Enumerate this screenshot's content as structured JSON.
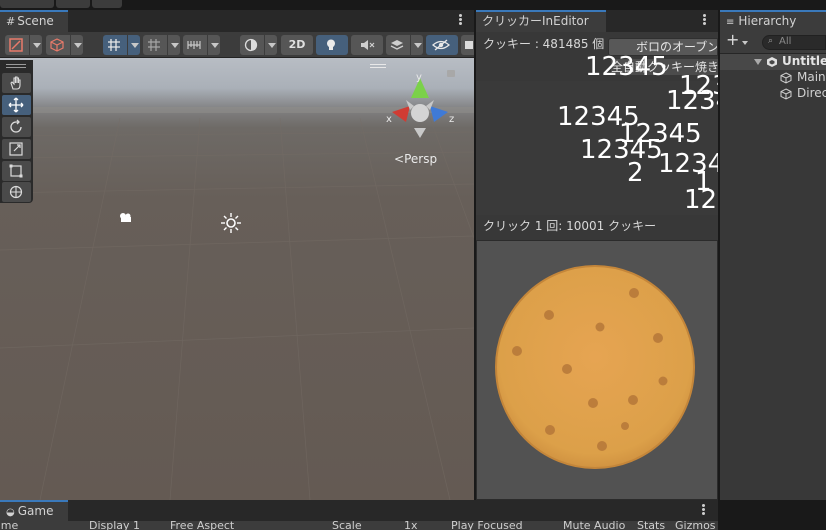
{
  "scene": {
    "tab_label": "Scene",
    "toolbar": {
      "toggle_2d_label": "2D"
    },
    "gizmo": {
      "x_label": "x",
      "y_label": "y",
      "z_label": "z",
      "projection_label": "Persp"
    }
  },
  "clicker": {
    "tab_label": "クリッカーInEditor",
    "cookie_count_text": "クッキー : 481485 個",
    "upgrade_button_label": "ボロのオーブン",
    "upgrade_overlay_text": "全自動クッキー焼き",
    "click_info_text": "クリック 1 回: 10001 クッキー",
    "floating_numbers": [
      "12345",
      "12345",
      "12345",
      "12345",
      "12345",
      "12345",
      "2",
      "1234",
      "1",
      "12"
    ]
  },
  "hierarchy": {
    "tab_label": "Hierarchy",
    "search_placeholder": "All",
    "scene_label": "Untitled",
    "items": [
      "Main",
      "Direc"
    ]
  },
  "game": {
    "tab_label": "Game",
    "toolbar": [
      "ame",
      "Display 1",
      "Free Aspect",
      "Scale",
      "1x",
      "Play Focused",
      "Mute Audio",
      "Stats",
      "Gizmos"
    ]
  },
  "colors": {
    "accent": "#3a79bb",
    "cookie": "#e0a04e",
    "cookie_spot": "#b87a3a",
    "scene_ground": "#645a53",
    "panel_bg": "#383838"
  }
}
